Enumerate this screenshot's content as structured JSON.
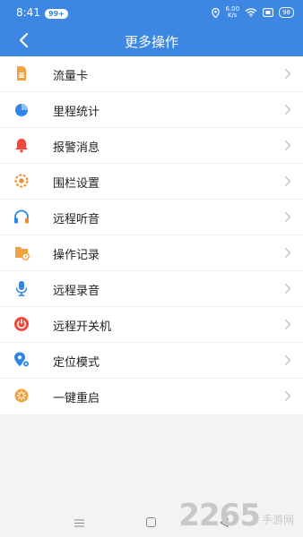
{
  "status_bar": {
    "time": "8:41",
    "badge": "99+",
    "speed_value": "6.00",
    "speed_unit": "K/s",
    "battery": "98"
  },
  "header": {
    "title": "更多操作"
  },
  "menu": [
    {
      "label": "流量卡",
      "icon": "sim-card-icon"
    },
    {
      "label": "里程统计",
      "icon": "pie-chart-icon"
    },
    {
      "label": "报警消息",
      "icon": "alarm-bell-icon"
    },
    {
      "label": "围栏设置",
      "icon": "fence-icon"
    },
    {
      "label": "远程听音",
      "icon": "headphones-icon"
    },
    {
      "label": "操作记录",
      "icon": "record-icon"
    },
    {
      "label": "远程录音",
      "icon": "microphone-icon"
    },
    {
      "label": "远程开关机",
      "icon": "power-icon"
    },
    {
      "label": "定位模式",
      "icon": "location-mode-icon"
    },
    {
      "label": "一键重启",
      "icon": "restart-icon"
    }
  ],
  "watermark": {
    "number": "2265",
    "text": "手游网"
  },
  "colors": {
    "header_bg": "#3d87e3"
  }
}
